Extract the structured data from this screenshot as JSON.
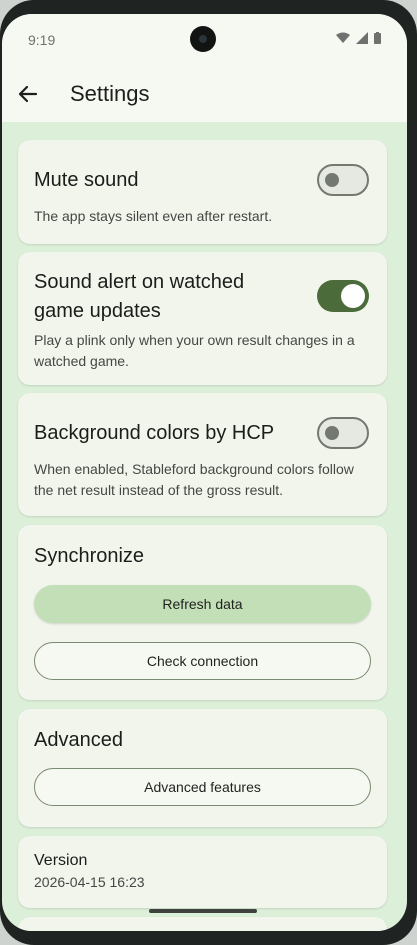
{
  "status": {
    "time": "9:19"
  },
  "appbar": {
    "title": "Settings"
  },
  "settings": [
    {
      "title": "Mute sound",
      "desc": "The app stays silent even after restart.",
      "enabled": false
    },
    {
      "title": "Sound alert on watched game updates",
      "desc": "Play a plink only when your own result changes in a watched game.",
      "enabled": true
    },
    {
      "title": "Background colors by HCP",
      "desc": "When enabled, Stableford background colors follow the net result instead of the gross result.",
      "enabled": false
    }
  ],
  "sync": {
    "title": "Synchronize",
    "refresh_label": "Refresh data",
    "check_label": "Check connection"
  },
  "advanced": {
    "title": "Advanced",
    "features_label": "Advanced features"
  },
  "version": {
    "label": "Version",
    "value": "2026-04-15 16:23"
  },
  "colors": {
    "accent": "#4c6b3a",
    "background": "#dcefd9",
    "card": "#f2f5ec",
    "button_filled": "#c3dfb8"
  }
}
